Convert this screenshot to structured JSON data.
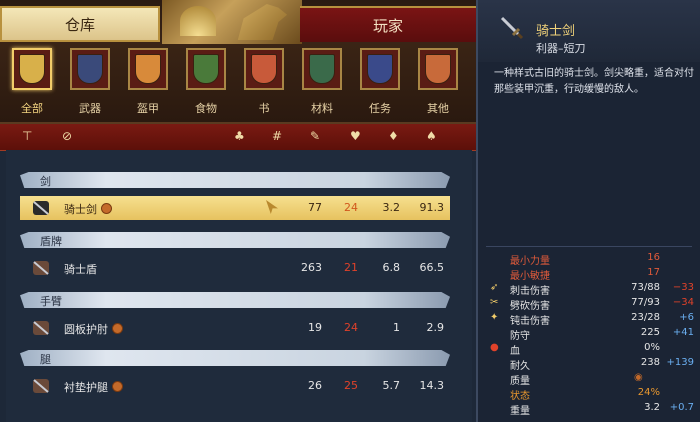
{
  "tabs": {
    "storage": "仓库",
    "player": "玩家"
  },
  "categories": [
    {
      "label": "全部",
      "icon": "all-items-icon",
      "color": "#d8b04a",
      "selected": true
    },
    {
      "label": "武器",
      "icon": "weapon-icon",
      "color": "#3a4a7a",
      "selected": false
    },
    {
      "label": "盔甲",
      "icon": "armor-icon",
      "color": "#d88a3a",
      "selected": false
    },
    {
      "label": "食物",
      "icon": "food-icon",
      "color": "#4a7a3a",
      "selected": false
    },
    {
      "label": "书",
      "icon": "book-icon",
      "color": "#c85a3a",
      "selected": false
    },
    {
      "label": "材料",
      "icon": "material-icon",
      "color": "#3a6a4a",
      "selected": false
    },
    {
      "label": "任务",
      "icon": "quest-icon",
      "color": "#3a4a8a",
      "selected": false
    },
    {
      "label": "其他",
      "icon": "other-icon",
      "color": "#c86a3a",
      "selected": false
    }
  ],
  "filter_icons": [
    "sort-icon",
    "compare-icon",
    "armor-stat-icon",
    "count-icon",
    "strength-icon",
    "durability-icon",
    "weight-icon",
    "value-icon"
  ],
  "groups": [
    {
      "title": "剑",
      "items": [
        {
          "name": "骑士剑",
          "v1": "77",
          "v2": "24",
          "v3": "3.2",
          "v4": "91.3",
          "selected": true,
          "icon": "sword-icon",
          "coin": true
        }
      ]
    },
    {
      "title": "盾牌",
      "items": [
        {
          "name": "骑士盾",
          "v1": "263",
          "v2": "21",
          "v3": "6.8",
          "v4": "66.5",
          "selected": false,
          "icon": "shield-icon",
          "coin": false
        }
      ]
    },
    {
      "title": "手臂",
      "items": [
        {
          "name": "圆板护肘",
          "v1": "19",
          "v2": "24",
          "v3": "1",
          "v4": "2.9",
          "selected": false,
          "icon": "elbow-guard-icon",
          "coin": true
        }
      ]
    },
    {
      "title": "腿",
      "items": [
        {
          "name": "衬垫护腿",
          "v1": "26",
          "v2": "25",
          "v3": "5.7",
          "v4": "14.3",
          "selected": false,
          "icon": "leg-guard-icon",
          "coin": true
        }
      ]
    }
  ],
  "detail": {
    "name": "骑士剑",
    "subtype": "利器–短刀",
    "description": "一种样式古旧的骑士剑。剑尖略重，适合对付那些装甲沉重，行动缓慢的敌人。",
    "stats": [
      {
        "key": "最小力量",
        "value": "16",
        "delta": "",
        "style": "red",
        "icon": ""
      },
      {
        "key": "最小敏捷",
        "value": "17",
        "delta": "",
        "style": "red",
        "icon": ""
      },
      {
        "key": "刺击伤害",
        "value": "73/88",
        "delta": "−33",
        "style": "",
        "icon": "pierce-icon"
      },
      {
        "key": "劈砍伤害",
        "value": "77/93",
        "delta": "−34",
        "style": "",
        "icon": "slash-icon"
      },
      {
        "key": "钝击伤害",
        "value": "23/28",
        "delta": "+6",
        "style": "",
        "icon": "blunt-icon"
      },
      {
        "key": "防守",
        "value": "225",
        "delta": "+41",
        "style": "",
        "icon": ""
      },
      {
        "key": "血",
        "value": "0%",
        "delta": "",
        "style": "",
        "icon": "blood-icon"
      },
      {
        "key": "耐久",
        "value": "238",
        "delta": "+139",
        "style": "",
        "icon": ""
      },
      {
        "key": "质量",
        "value": "",
        "delta": "",
        "style": "",
        "icon": "quality-icon"
      },
      {
        "key": "状态",
        "value": "24%",
        "delta": "",
        "style": "orange",
        "icon": ""
      },
      {
        "key": "重量",
        "value": "3.2",
        "delta": "+0.7",
        "style": "",
        "icon": ""
      }
    ]
  }
}
